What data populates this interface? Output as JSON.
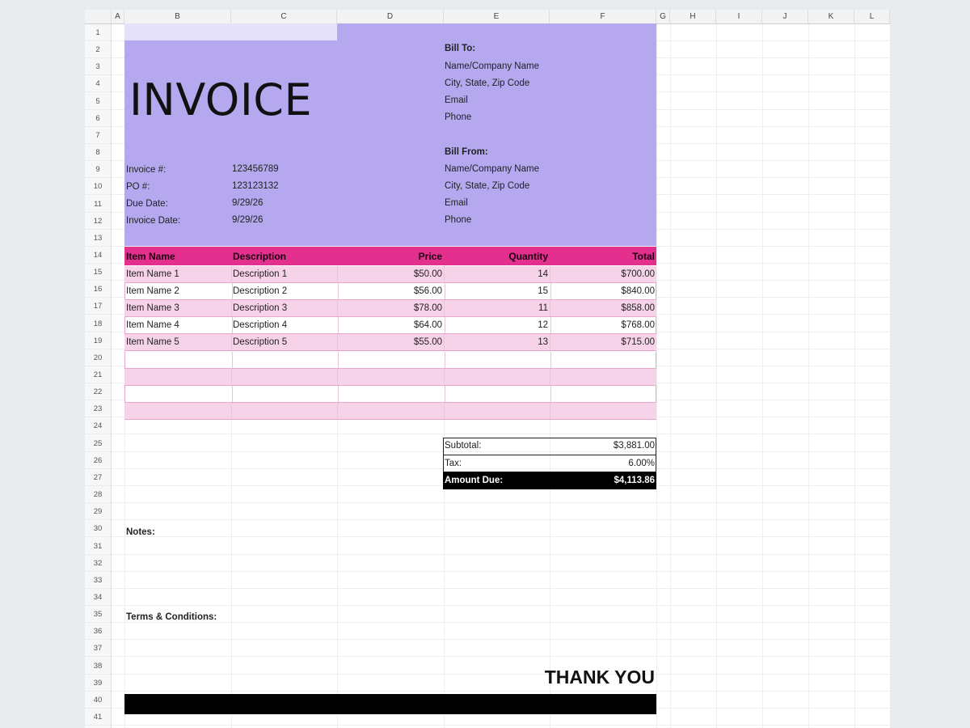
{
  "columns": [
    "A",
    "B",
    "C",
    "D",
    "E",
    "F",
    "G",
    "H",
    "I",
    "J",
    "K",
    "L"
  ],
  "rows": [
    "1",
    "2",
    "3",
    "4",
    "5",
    "6",
    "7",
    "8",
    "9",
    "10",
    "11",
    "12",
    "13",
    "14",
    "15",
    "16",
    "17",
    "18",
    "19",
    "20",
    "21",
    "22",
    "23",
    "24",
    "25",
    "26",
    "27",
    "28",
    "29",
    "30",
    "31",
    "32",
    "33",
    "34",
    "35",
    "36",
    "37",
    "38",
    "39",
    "40",
    "41"
  ],
  "header": {
    "title": "INVOICE",
    "bill_to": {
      "label": "Bill To:",
      "name": "Name/Company Name",
      "address": "City, State, Zip Code",
      "email": "Email",
      "phone": "Phone"
    },
    "bill_from": {
      "label": "Bill From:",
      "name": "Name/Company Name",
      "address": "City, State, Zip Code",
      "email": "Email",
      "phone": "Phone"
    },
    "fields": [
      {
        "label": "Invoice #:",
        "value": "123456789"
      },
      {
        "label": "PO #:",
        "value": "123123132"
      },
      {
        "label": "Due Date:",
        "value": "9/29/26"
      },
      {
        "label": "Invoice Date:",
        "value": "9/29/26"
      }
    ]
  },
  "table": {
    "headers": [
      "Item Name",
      "Description",
      "Price",
      "Quantity",
      "Total"
    ],
    "rows": [
      {
        "item": "Item Name 1",
        "description": "Description 1",
        "price": "$50.00",
        "quantity": "14",
        "total": "$700.00"
      },
      {
        "item": "Item Name 2",
        "description": "Description 2",
        "price": "$56.00",
        "quantity": "15",
        "total": "$840.00"
      },
      {
        "item": "Item Name 3",
        "description": "Description 3",
        "price": "$78.00",
        "quantity": "11",
        "total": "$858.00"
      },
      {
        "item": "Item Name 4",
        "description": "Description 4",
        "price": "$64.00",
        "quantity": "12",
        "total": "$768.00"
      },
      {
        "item": "Item Name 5",
        "description": "Description 5",
        "price": "$55.00",
        "quantity": "13",
        "total": "$715.00"
      }
    ]
  },
  "totals": {
    "subtotal_label": "Subtotal:",
    "subtotal": "$3,881.00",
    "tax_label": "Tax:",
    "tax": "6.00%",
    "amount_due_label": "Amount Due:",
    "amount_due": "$4,113.86"
  },
  "notes_label": "Notes:",
  "terms_label": "Terms & Conditions:",
  "thank_you": "THANK YOU",
  "colors": {
    "header_bg": "#b5a8ee",
    "table_header": "#e3308e",
    "table_row_pink": "#f7d3e9",
    "footer": "#000000"
  }
}
